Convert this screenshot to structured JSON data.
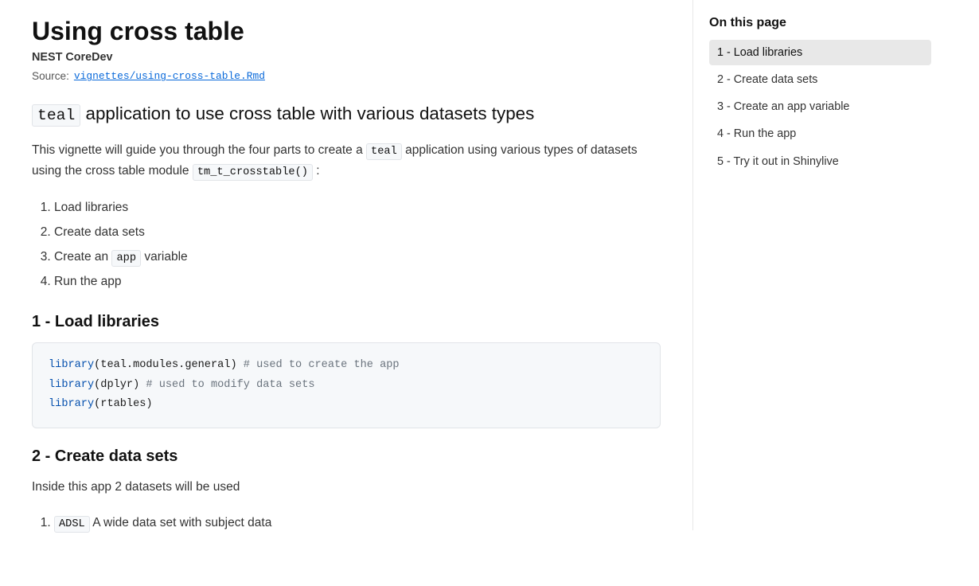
{
  "page": {
    "title": "Using cross table",
    "author": "NEST CoreDev",
    "source_label": "Source:",
    "source_link_text": "vignettes/using-cross-table.Rmd",
    "source_link_href": "vignettes/using-cross-table.Rmd"
  },
  "intro": {
    "heading_pre": "teal",
    "heading_post": " application to use cross table with various datasets types",
    "para1_pre": "This vignette will guide you through the four parts to create a ",
    "para1_code1": "teal",
    "para1_mid": " application using various types of datasets using the cross table module ",
    "para1_code2": "tm_t_crosstable()",
    "para1_end": " :"
  },
  "overview_list": {
    "items": [
      {
        "text": "Load libraries"
      },
      {
        "text": "Create data sets"
      },
      {
        "text_pre": "Create an ",
        "code": "app",
        "text_post": " variable"
      },
      {
        "text": "Run the app"
      }
    ]
  },
  "sections": [
    {
      "id": "load-libraries",
      "heading": "1 - Load libraries",
      "type": "code",
      "code_lines": [
        {
          "fn": "library",
          "arg": "teal.modules.general",
          "comment": "# used to create the app"
        },
        {
          "fn": "library",
          "arg": "dplyr",
          "comment": "# used to modify data sets"
        },
        {
          "fn": "library",
          "arg": "rtables",
          "comment": ""
        }
      ]
    },
    {
      "id": "create-data-sets",
      "heading": "2 - Create data sets",
      "type": "text",
      "text": "Inside this app 2 datasets will be used"
    }
  ],
  "datasets_list": {
    "items": [
      {
        "code": "ADSL",
        "text": " A wide data set with subject data"
      }
    ]
  },
  "sidebar": {
    "title": "On this page",
    "nav_items": [
      {
        "label": "1 - Load libraries",
        "href": "#load-libraries",
        "active": true
      },
      {
        "label": "2 - Create data sets",
        "href": "#create-data-sets",
        "active": false
      },
      {
        "label": "3 - Create an app variable",
        "href": "#create-app-variable",
        "active": false
      },
      {
        "label": "4 - Run the app",
        "href": "#run-the-app",
        "active": false
      },
      {
        "label": "5 - Try it out in Shinylive",
        "href": "#shinylive",
        "active": false
      }
    ]
  }
}
